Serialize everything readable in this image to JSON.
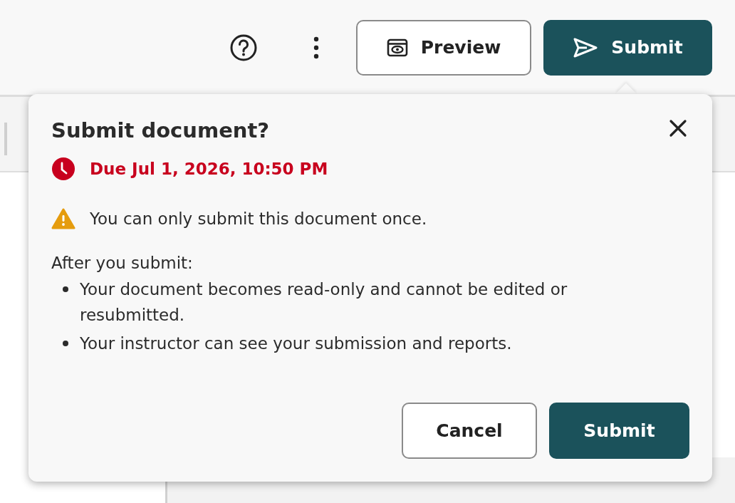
{
  "toolbar": {
    "buttons": [
      {
        "label": "Preview",
        "kind": "secondary"
      },
      {
        "label": "Submit",
        "kind": "primary"
      }
    ]
  },
  "dialog": {
    "title": "Submit document?",
    "due": "Due Jul 1, 2026, 10:50 PM",
    "warning": "You can only submit this document once.",
    "intro": "After you submit:",
    "bullets": [
      "Your document becomes read-only and cannot be edited or resubmitted.",
      "Your instructor can see your submission and reports."
    ],
    "buttons": [
      {
        "label": "Cancel",
        "kind": "secondary"
      },
      {
        "label": "Submit",
        "kind": "primary"
      }
    ]
  }
}
